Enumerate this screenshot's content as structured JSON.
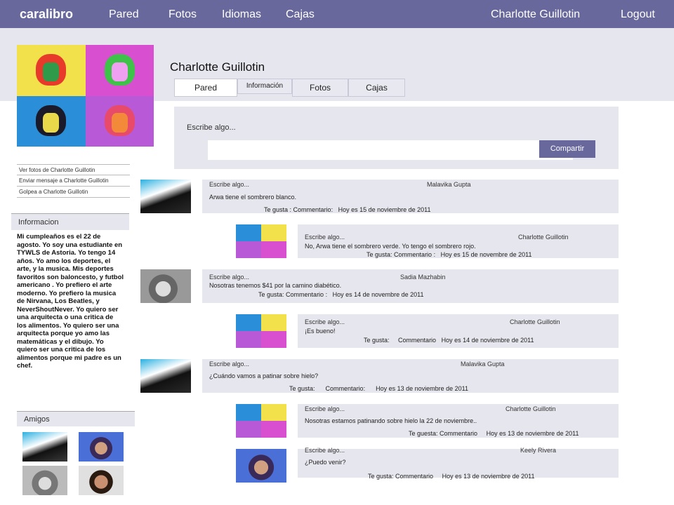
{
  "nav": {
    "brand": "caralibro",
    "links": [
      "Pared",
      "Fotos",
      "Idiomas",
      "Cajas"
    ],
    "user": "Charlotte Guillotin",
    "logout": "Logout"
  },
  "profile": {
    "name": "Charlotte Guillotin",
    "tabs": [
      "Pared",
      "Información",
      "Fotos",
      "Cajas"
    ]
  },
  "sidebar": {
    "links": [
      "Ver fotos de Charlotte Guillotin",
      "Enviar mensaje a Charlotte Guillotin",
      "Golpea a Charlotte Guillotin"
    ],
    "info_heading": "Informacion",
    "info_text": "Mi cumpleaños es el 22 de agosto. Yo soy una estudiante en TYWLS de Astoria. Yo tengo 14 años. Yo amo los deportes, el arte, y la musica. Mis deportes favoritos son baloncesto, y futbol americano . Yo prefiero el arte moderno. Yo prefiero la musica de Nirvana, Los Beatles, y NeverShoutNever. Yo quiero ser una arquitecta o una critica de los alimentos. Yo quiero ser una arquitecta porque yo amo las matemáticas y el dibujo. Yo quiero ser una critica de los alimentos porque mi padre es un chef.",
    "friends_heading": "Amigos"
  },
  "composer": {
    "prompt": "Escribe algo...",
    "placeholder": "",
    "share": "Compartir"
  },
  "posts": [
    {
      "label": "Escribe algo...",
      "author": "Malavika Gupta",
      "text": "Arwa tiene el sombrero blanco.",
      "likes": "Te gusta :",
      "comment": "Commentario:",
      "date": "Hoy es 15 de noviembre de 2011"
    },
    {
      "label": "Escribe algo...",
      "author": "Charlotte Guillotin",
      "text": "No, Arwa tiene el sombrero verde. Yo tengo el sombrero rojo.",
      "likes": "Te gusta:",
      "comment": "Commentario :",
      "date": "Hoy es 15 de novembre de 2011"
    },
    {
      "label": "Escribe algo...",
      "author": "Sadia Mazhabin",
      "text": "Nosotras tenemos $41 por la camino diabético.",
      "likes": "Te gusta:",
      "comment": "Commentario :",
      "date": "Hoy es 14 de novembre de 2011"
    },
    {
      "label": "Escribe algo...",
      "author": "Charlotte Guillotin",
      "text": "¡Es bueno!",
      "likes": "Te gusta:",
      "comment": "Commentario",
      "date": "Hoy es 14 de noviembre de 2011"
    },
    {
      "label": "Escribe algo...",
      "author": "Malavika Gupta",
      "text": "¿Cuándo vamos a patinar sobre hielo?",
      "likes": "Te gusta:",
      "comment": "Commentario:",
      "date": "Hoy es 13 de noviembre de 2011"
    },
    {
      "label": "Escribe algo...",
      "author": "Charlotte Guillotin",
      "text": "Nosotras estamos patinando sobre hielo la 22 de noviembre..",
      "likes": "Te guesta:",
      "comment": "Commentario",
      "date": "Hoy es 13 de noviembre de 2011"
    },
    {
      "label": "Escribe algo...",
      "author": "Keely Rivera",
      "text": "¿Puedo venir?",
      "likes": "Te gusta:",
      "comment": "Commentario",
      "date": "Hoy es 13 de noviembre de 2011"
    }
  ]
}
